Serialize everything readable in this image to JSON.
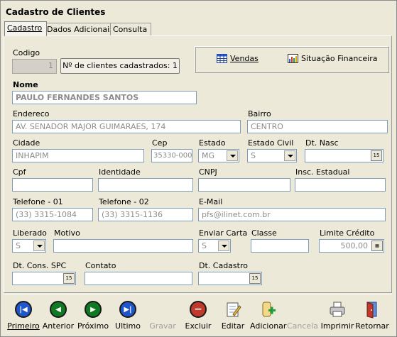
{
  "window": {
    "title": "Cadastro de Clientes"
  },
  "tabs": [
    {
      "label": "Cadastro",
      "active": true
    },
    {
      "label": "Dados Adicionais",
      "active": false
    },
    {
      "label": "Consulta",
      "active": false
    }
  ],
  "form": {
    "codigo": {
      "label": "Codigo",
      "value": "1"
    },
    "clients_count": "Nº de clientes cadastrados: 1",
    "nome": {
      "label": "Nome",
      "value": "PAULO FERNANDES SANTOS"
    },
    "endereco": {
      "label": "Endereco",
      "value": "AV. SENADOR MAJOR GUIMARAES, 174"
    },
    "bairro": {
      "label": "Bairro",
      "value": "CENTRO"
    },
    "cidade": {
      "label": "Cidade",
      "value": "INHAPIM"
    },
    "cep": {
      "label": "Cep",
      "value": "35330-000"
    },
    "estado": {
      "label": "Estado",
      "value": "MG"
    },
    "estado_civil": {
      "label": "Estado Civil",
      "value": "S"
    },
    "dt_nasc": {
      "label": "Dt. Nasc",
      "value": "  /  /"
    },
    "cpf": {
      "label": "Cpf",
      "value": ""
    },
    "identidade": {
      "label": "Identidade",
      "value": ""
    },
    "cnpj": {
      "label": "CNPJ",
      "value": ""
    },
    "insc_estadual": {
      "label": "Insc. Estadual",
      "value": ""
    },
    "telefone1": {
      "label": "Telefone - 01",
      "value": "(33) 3315-1084"
    },
    "telefone2": {
      "label": "Telefone - 02",
      "value": "(33) 3315-1136"
    },
    "email": {
      "label": "E-Mail",
      "value": "pfs@ilinet.com.br"
    },
    "liberado": {
      "label": "Liberado",
      "value": "S"
    },
    "motivo": {
      "label": "Motivo",
      "value": ""
    },
    "enviar_carta": {
      "label": "Enviar Carta",
      "value": "S"
    },
    "classe": {
      "label": "Classe",
      "value": ""
    },
    "limite_credito": {
      "label": "Limite Crédito",
      "value": "500,00"
    },
    "dt_cons_spc": {
      "label": "Dt. Cons. SPC",
      "value": "  /  /"
    },
    "contato": {
      "label": "Contato",
      "value": ""
    },
    "dt_cadastro": {
      "label": "Dt. Cadastro",
      "value": "  /  /"
    },
    "calendar_glyph": "15"
  },
  "actions": {
    "vendas": "Vendas",
    "situacao": "Situação Financeira"
  },
  "toolbar": [
    {
      "label": "Primeiro",
      "icon": "first-record-icon",
      "enabled": true
    },
    {
      "label": "Anterior",
      "icon": "previous-record-icon",
      "enabled": true
    },
    {
      "label": "Próximo",
      "icon": "next-record-icon",
      "enabled": true
    },
    {
      "label": "Ultimo",
      "icon": "last-record-icon",
      "enabled": true
    },
    {
      "label": "Gravar",
      "icon": "save-icon",
      "enabled": false
    },
    {
      "label": "Excluir",
      "icon": "delete-icon",
      "enabled": true
    },
    {
      "label": "Editar",
      "icon": "edit-icon",
      "enabled": true
    },
    {
      "label": "Adicionar",
      "icon": "add-icon",
      "enabled": true
    },
    {
      "label": "Cancela",
      "icon": "cancel-icon",
      "enabled": false
    },
    {
      "label": "Imprimir",
      "icon": "printer-icon",
      "enabled": true
    },
    {
      "label": "Retornar",
      "icon": "exit-door-icon",
      "enabled": true
    }
  ],
  "colors": {
    "window_bg": "#ece9d8",
    "field_border": "#7f9db9",
    "readonly_text": "#8c8c8c",
    "nav_blue": "#1f56c9",
    "nav_green": "#0f7a22",
    "delete_red": "#c0392b"
  }
}
